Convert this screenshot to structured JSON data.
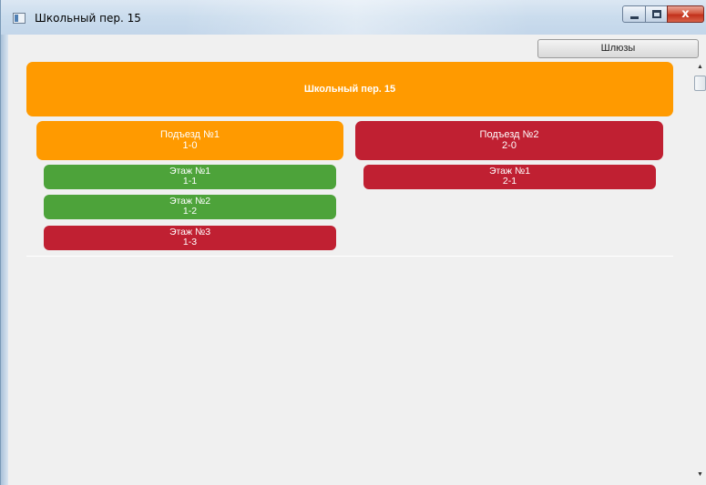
{
  "window": {
    "title": "Школьный пер. 15",
    "close_glyph": "x"
  },
  "toolbar": {
    "gates_label": "Шлюзы"
  },
  "building": {
    "name": "Школьный пер. 15"
  },
  "entrances": [
    {
      "name": "Подъезд №1",
      "code": "1-0",
      "color": "#ff9a00",
      "floors": [
        {
          "name": "Этаж №1",
          "code": "1-1",
          "color": "#4da33a"
        },
        {
          "name": "Этаж №2",
          "code": "1-2",
          "color": "#4da33a"
        },
        {
          "name": "Этаж №3",
          "code": "1-3",
          "color": "#c02032"
        }
      ]
    },
    {
      "name": "Подъезд №2",
      "code": "2-0",
      "color": "#c02032",
      "floors": [
        {
          "name": "Этаж №1",
          "code": "2-1",
          "color": "#c02032"
        }
      ]
    }
  ],
  "colors": {
    "building": "#ff9a00",
    "ok": "#4da33a",
    "alarm": "#c02032",
    "warning": "#ff9a00"
  }
}
